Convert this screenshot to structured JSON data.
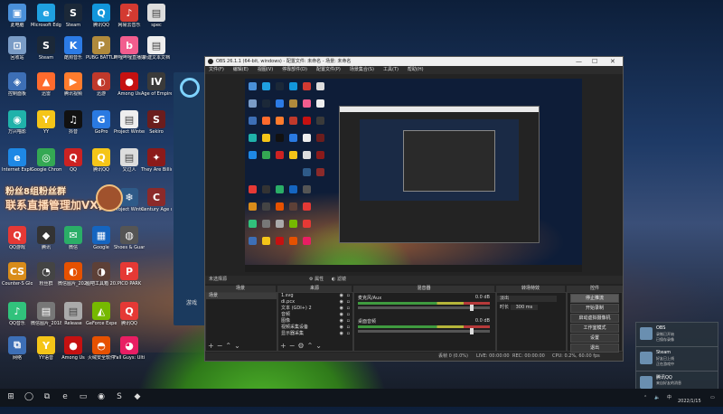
{
  "desktop": {
    "icons": [
      {
        "label": "此电脑",
        "glyph": "▣",
        "color": "#4a90d9",
        "col": 0,
        "row": 0
      },
      {
        "label": "Microsoft Edge",
        "glyph": "e",
        "color": "#1fa0e0",
        "col": 1,
        "row": 0
      },
      {
        "label": "Steam",
        "glyph": "S",
        "color": "#1b2838",
        "col": 2,
        "row": 0
      },
      {
        "label": "腾讯QQ",
        "glyph": "Q",
        "color": "#1296db",
        "col": 3,
        "row": 0
      },
      {
        "label": "网易云音乐",
        "glyph": "♪",
        "color": "#d33a31",
        "col": 4,
        "row": 0
      },
      {
        "label": "spec",
        "glyph": "▤",
        "color": "#ddd",
        "col": 5,
        "row": 0
      },
      {
        "label": "回收站",
        "glyph": "⊡",
        "color": "#7a9cc6",
        "col": 0,
        "row": 1
      },
      {
        "label": "Steam",
        "glyph": "S",
        "color": "#1b2838",
        "col": 1,
        "row": 1
      },
      {
        "label": "酷狗音乐",
        "glyph": "K",
        "color": "#2c7be5",
        "col": 2,
        "row": 1
      },
      {
        "label": "PUBG BATTLEG...",
        "glyph": "P",
        "color": "#b08a3c",
        "col": 3,
        "row": 1
      },
      {
        "label": "哔哩哔哩直播姬",
        "glyph": "b",
        "color": "#f25d8e",
        "col": 4,
        "row": 1
      },
      {
        "label": "新建文本文档",
        "glyph": "▤",
        "color": "#eee",
        "col": 5,
        "row": 1
      },
      {
        "label": "控制面板",
        "glyph": "◈",
        "color": "#3d6fb6",
        "col": 0,
        "row": 2
      },
      {
        "label": "迅雷",
        "glyph": "▲",
        "color": "#ff6b2d",
        "col": 1,
        "row": 2
      },
      {
        "label": "腾讯视频",
        "glyph": "▶",
        "color": "#ff7c2d",
        "col": 2,
        "row": 2
      },
      {
        "label": "迅游",
        "glyph": "◐",
        "color": "#c0392b",
        "col": 3,
        "row": 2
      },
      {
        "label": "Among Us",
        "glyph": "●",
        "color": "#c51111",
        "col": 4,
        "row": 2
      },
      {
        "label": "Age of Empires IV",
        "glyph": "IV",
        "color": "#3a3a3a",
        "col": 5,
        "row": 2
      },
      {
        "label": "万兴喵影",
        "glyph": "◉",
        "color": "#20b2aa",
        "col": 0,
        "row": 3
      },
      {
        "label": "YY",
        "glyph": "Y",
        "color": "#f5c518",
        "col": 1,
        "row": 3
      },
      {
        "label": "抖音",
        "glyph": "♫",
        "color": "#111",
        "col": 2,
        "row": 3
      },
      {
        "label": "GoPro",
        "glyph": "G",
        "color": "#2a7ae2",
        "col": 3,
        "row": 3
      },
      {
        "label": "Project Winter",
        "glyph": "▤",
        "color": "#eee",
        "col": 4,
        "row": 3
      },
      {
        "label": "Sekiro",
        "glyph": "S",
        "color": "#6b1d1d",
        "col": 5,
        "row": 3
      },
      {
        "label": "Internet Explorer",
        "glyph": "e",
        "color": "#1e88e5",
        "col": 0,
        "row": 4
      },
      {
        "label": "Google Chrome",
        "glyph": "◎",
        "color": "#34a853",
        "col": 1,
        "row": 4
      },
      {
        "label": "QQ",
        "glyph": "Q",
        "color": "#cc2222",
        "col": 2,
        "row": 4
      },
      {
        "label": "腾讯QQ",
        "glyph": "Q",
        "color": "#f5c518",
        "col": 3,
        "row": 4
      },
      {
        "label": "又过人",
        "glyph": "▤",
        "color": "#ddd",
        "col": 4,
        "row": 4
      },
      {
        "label": "They Are Billions",
        "glyph": "✦",
        "color": "#8b1a1a",
        "col": 5,
        "row": 4
      },
      {
        "label": "Project Winter",
        "glyph": "❄",
        "color": "#2e5a88",
        "col": 4,
        "row": 5
      },
      {
        "label": "Century Age of Ashes",
        "glyph": "C",
        "color": "#8b2a2a",
        "col": 5,
        "row": 5
      },
      {
        "label": "QQ游戏",
        "glyph": "Q",
        "color": "#e53935",
        "col": 0,
        "row": 6
      },
      {
        "label": "腾讯",
        "glyph": "◆",
        "color": "#333",
        "col": 1,
        "row": 6
      },
      {
        "label": "微信",
        "glyph": "✉",
        "color": "#2aae67",
        "col": 2,
        "row": 6
      },
      {
        "label": "Google",
        "glyph": "▦",
        "color": "#1565c0",
        "col": 3,
        "row": 6
      },
      {
        "label": "Shoes & Guard",
        "glyph": "◍",
        "color": "#555",
        "col": 4,
        "row": 6
      },
      {
        "label": "Counter-S Global Off...",
        "glyph": "CS",
        "color": "#d98c1a",
        "col": 0,
        "row": 7
      },
      {
        "label": "粉丝群",
        "glyph": "◔",
        "color": "#444",
        "col": 1,
        "row": 7
      },
      {
        "label": "微信图片_2020101...",
        "glyph": "◐",
        "color": "#e65100",
        "col": 2,
        "row": 7
      },
      {
        "label": "图吧工具箱 2020",
        "glyph": "◑",
        "color": "#5d4037",
        "col": 3,
        "row": 7
      },
      {
        "label": "PICO PARK",
        "glyph": "P",
        "color": "#e53935",
        "col": 4,
        "row": 7
      },
      {
        "label": "QQ音乐",
        "glyph": "♪",
        "color": "#31c27c",
        "col": 0,
        "row": 8
      },
      {
        "label": "微信图片_2018101...",
        "glyph": "▤",
        "color": "#777",
        "col": 1,
        "row": 8
      },
      {
        "label": "Release",
        "glyph": "▤",
        "color": "#aaa",
        "col": 2,
        "row": 8
      },
      {
        "label": "GeForce Experience",
        "glyph": "◭",
        "color": "#76b900",
        "col": 3,
        "row": 8
      },
      {
        "label": "腾讯QQ",
        "glyph": "Q",
        "color": "#e53935",
        "col": 4,
        "row": 8
      },
      {
        "label": "网络",
        "glyph": "⧉",
        "color": "#3d6fb6",
        "col": 0,
        "row": 9
      },
      {
        "label": "YY语音",
        "glyph": "Y",
        "color": "#f5c518",
        "col": 1,
        "row": 9
      },
      {
        "label": "Among Us",
        "glyph": "●",
        "color": "#c51111",
        "col": 2,
        "row": 9
      },
      {
        "label": "火绒安全软件",
        "glyph": "◓",
        "color": "#e65100",
        "col": 3,
        "row": 9
      },
      {
        "label": "Fall Guys: Ultimate Knockout",
        "glyph": "◕",
        "color": "#e91e63",
        "col": 4,
        "row": 9
      }
    ],
    "banner_line1": "粉丝8组粉丝群",
    "banner_line2": "联系直播管理加VX群",
    "bg_window_text": "游戏"
  },
  "obs": {
    "title": "OBS 26.1.1 (64-bit, windows) - 配置文件: 未命名 - 场景: 未命名",
    "window_controls": [
      "—",
      "☐",
      "✕"
    ],
    "menu": [
      "文件(F)",
      "编辑(E)",
      "视图(V)",
      "停靠部件(D)",
      "配置文件(P)",
      "场景集合(S)",
      "工具(T)",
      "帮助(H)"
    ],
    "scene_bar": {
      "label": "未选择源",
      "properties": "属性",
      "filters": "滤镜"
    },
    "docks": {
      "scenes": {
        "title": "场景",
        "items": [
          "场景"
        ]
      },
      "sources": {
        "title": "来源",
        "items": [
          "1.svg",
          "di.pcx",
          "文本 (GDI+) 2",
          "音频",
          "图像",
          "视频采集设备",
          "显示器采集"
        ]
      },
      "mixer": {
        "title": "混音器",
        "channels": [
          {
            "name": "麦克风/Aux",
            "db": "0.0 dB"
          },
          {
            "name": "桌面音频",
            "db": "0.0 dB"
          }
        ]
      },
      "transitions": {
        "title": "转场特效",
        "type": "淡出",
        "duration_label": "时长",
        "duration_value": "300 ms"
      },
      "controls": {
        "title": "控件",
        "buttons": [
          "停止推流",
          "开始录制",
          "启动虚拟摄像机",
          "工作室模式",
          "设置",
          "退出"
        ]
      }
    },
    "status": {
      "drop": "丢帧 0 (0.0%)",
      "live": "LIVE: 00:00:00",
      "rec": "REC: 00:00:00",
      "cpu": "CPU: 0.2%, 60.00 fps"
    }
  },
  "notifications": [
    {
      "title": "OBS",
      "line1": "录制已开始",
      "line2": "已保存录像"
    },
    {
      "title": "Steam",
      "line1": "好友已上线",
      "line2": "正在游戏中"
    },
    {
      "title": "腾讯QQ",
      "line1": "来自好友的消息",
      "line2": "查看消息"
    }
  ],
  "taskbar": {
    "apps": [
      {
        "name": "start",
        "glyph": "⊞"
      },
      {
        "name": "search",
        "glyph": "◯"
      },
      {
        "name": "task-view",
        "glyph": "⧉"
      },
      {
        "name": "edge",
        "glyph": "e"
      },
      {
        "name": "explorer",
        "glyph": "▭"
      },
      {
        "name": "obs",
        "glyph": "◉"
      },
      {
        "name": "steam",
        "glyph": "S"
      },
      {
        "name": "qq",
        "glyph": "◆"
      }
    ],
    "clock_time": "",
    "clock_date": "2022/1/15",
    "tray_lang": "中"
  },
  "colors": {
    "accent": "#f48c32",
    "obs_bg": "#232323",
    "desktop_top": "#0d1f3a"
  }
}
